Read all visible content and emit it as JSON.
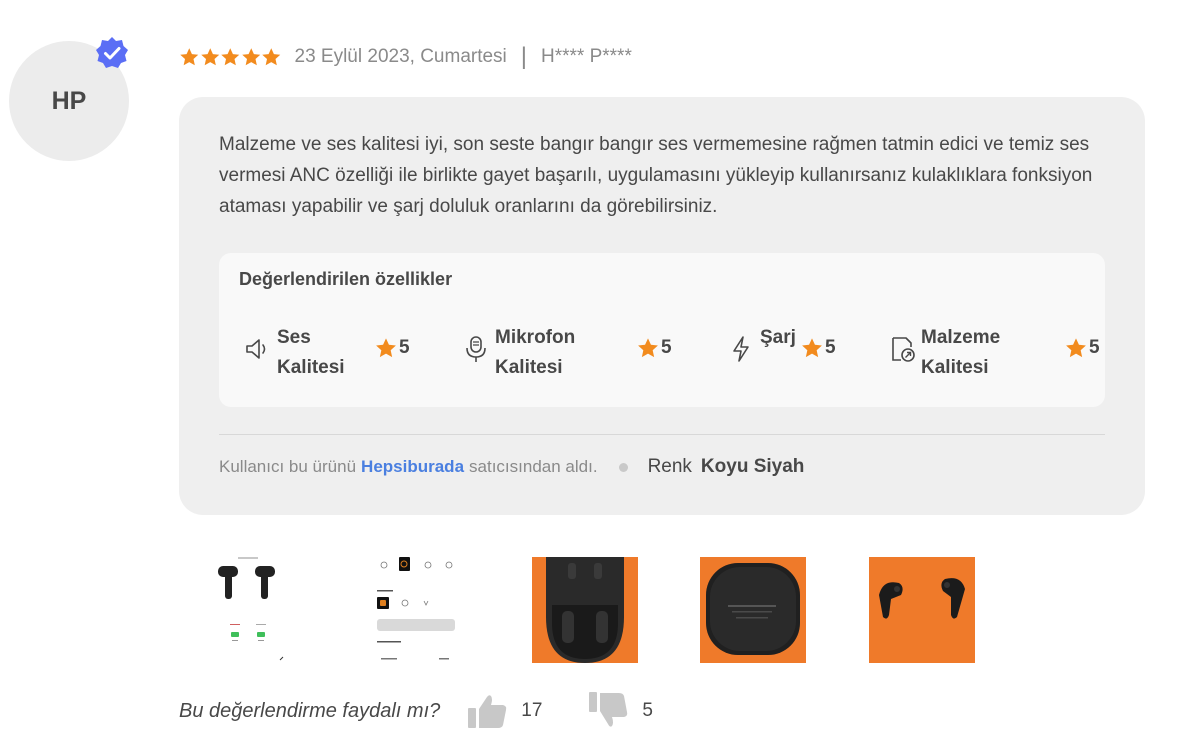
{
  "reviewer": {
    "initials": "HP",
    "verified_icon": "verified-badge-icon"
  },
  "meta": {
    "rating": 5,
    "date": "23 Eylül 2023, Cumartesi",
    "separator": "|",
    "user": "H**** P****"
  },
  "review": {
    "text": "Malzeme ve ses kalitesi iyi, son seste bangır bangır ses vermemesine rağmen tatmin edici ve temiz ses vermesi ANC özelliği ile birlikte gayet başarılı, uygulamasını yükleyip kullanırsanız kulaklıklara fonksiyon ataması yapabilir ve şarj doluluk oranlarını da görebilirsiniz."
  },
  "features": {
    "title": "Değerlendirilen özellikler",
    "items": [
      {
        "label": "Ses Kalitesi",
        "score": "5",
        "icon": "speaker-icon"
      },
      {
        "label": "Mikrofon Kalitesi",
        "score": "5",
        "icon": "microphone-icon"
      },
      {
        "label": "Şarj",
        "score": "5",
        "icon": "lightning-icon"
      },
      {
        "label": "Malzeme Kalitesi",
        "score": "5",
        "icon": "material-icon"
      }
    ]
  },
  "footer": {
    "pre": "Kullanıcı bu ürünü",
    "seller": "Hepsiburada",
    "post": "satıcısından aldı.",
    "color_label": "Renk",
    "color_value": "Koyu Siyah"
  },
  "helpful": {
    "question": "Bu değerlendirme faydalı mı?",
    "likes": "17",
    "dislikes": "5"
  },
  "colors": {
    "star": "#f28b1e",
    "accent": "#4a7fe0",
    "card": "#efefef",
    "verified": "#5b6ef5",
    "photo_bg": "#ef7a2a"
  }
}
